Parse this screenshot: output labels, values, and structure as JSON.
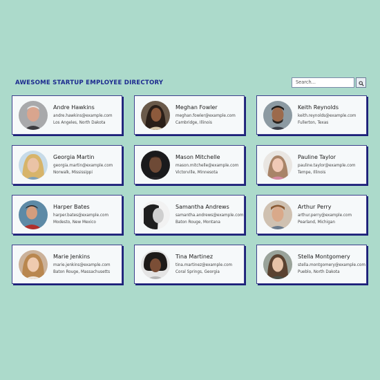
{
  "header": {
    "title": "AWESOME STARTUP EMPLOYEE DIRECTORY",
    "search_placeholder": "Search..."
  },
  "colors": {
    "background": "#acdacb",
    "title": "#1c2a8f",
    "card_border": "#1b1f78",
    "card_bg": "#f6f9fa"
  },
  "icons": {
    "search_button": "search-icon",
    "avatar": "user-photo"
  },
  "employees": [
    {
      "name": "Andre Hawkins",
      "email": "andre.hawkins@example.com",
      "location": "Los Angeles, North Dakota"
    },
    {
      "name": "Meghan Fowler",
      "email": "meghan.fowler@example.com",
      "location": "Cambridge, Illinois"
    },
    {
      "name": "Keith Reynolds",
      "email": "keith.reynolds@example.com",
      "location": "Fullerton, Texas"
    },
    {
      "name": "Georgia Martin",
      "email": "georgia.martin@example.com",
      "location": "Norwalk, Mississippi"
    },
    {
      "name": "Mason Mitchelle",
      "email": "mason.mitchelle@example.com",
      "location": "Victorville, Minnesota"
    },
    {
      "name": "Pauline Taylor",
      "email": "pauline.taylor@example.com",
      "location": "Tempe, Illinois"
    },
    {
      "name": "Harper Bates",
      "email": "harper.bates@example.com",
      "location": "Modesto, New Mexico"
    },
    {
      "name": "Samantha Andrews",
      "email": "samantha.andrews@example.com",
      "location": "Baton Rouge, Montana"
    },
    {
      "name": "Arthur Perry",
      "email": "arthur.perry@example.com",
      "location": "Pearland, Michigan"
    },
    {
      "name": "Marie Jenkins",
      "email": "marie.jenkins@example.com",
      "location": "Baton Rouge, Massachusetts"
    },
    {
      "name": "Tina Martinez",
      "email": "tina.martinez@example.com",
      "location": "Coral Springs, Georgia"
    },
    {
      "name": "Stella Montgomery",
      "email": "stella.montgomery@example.com",
      "location": "Pueblo, North Dakota"
    }
  ]
}
